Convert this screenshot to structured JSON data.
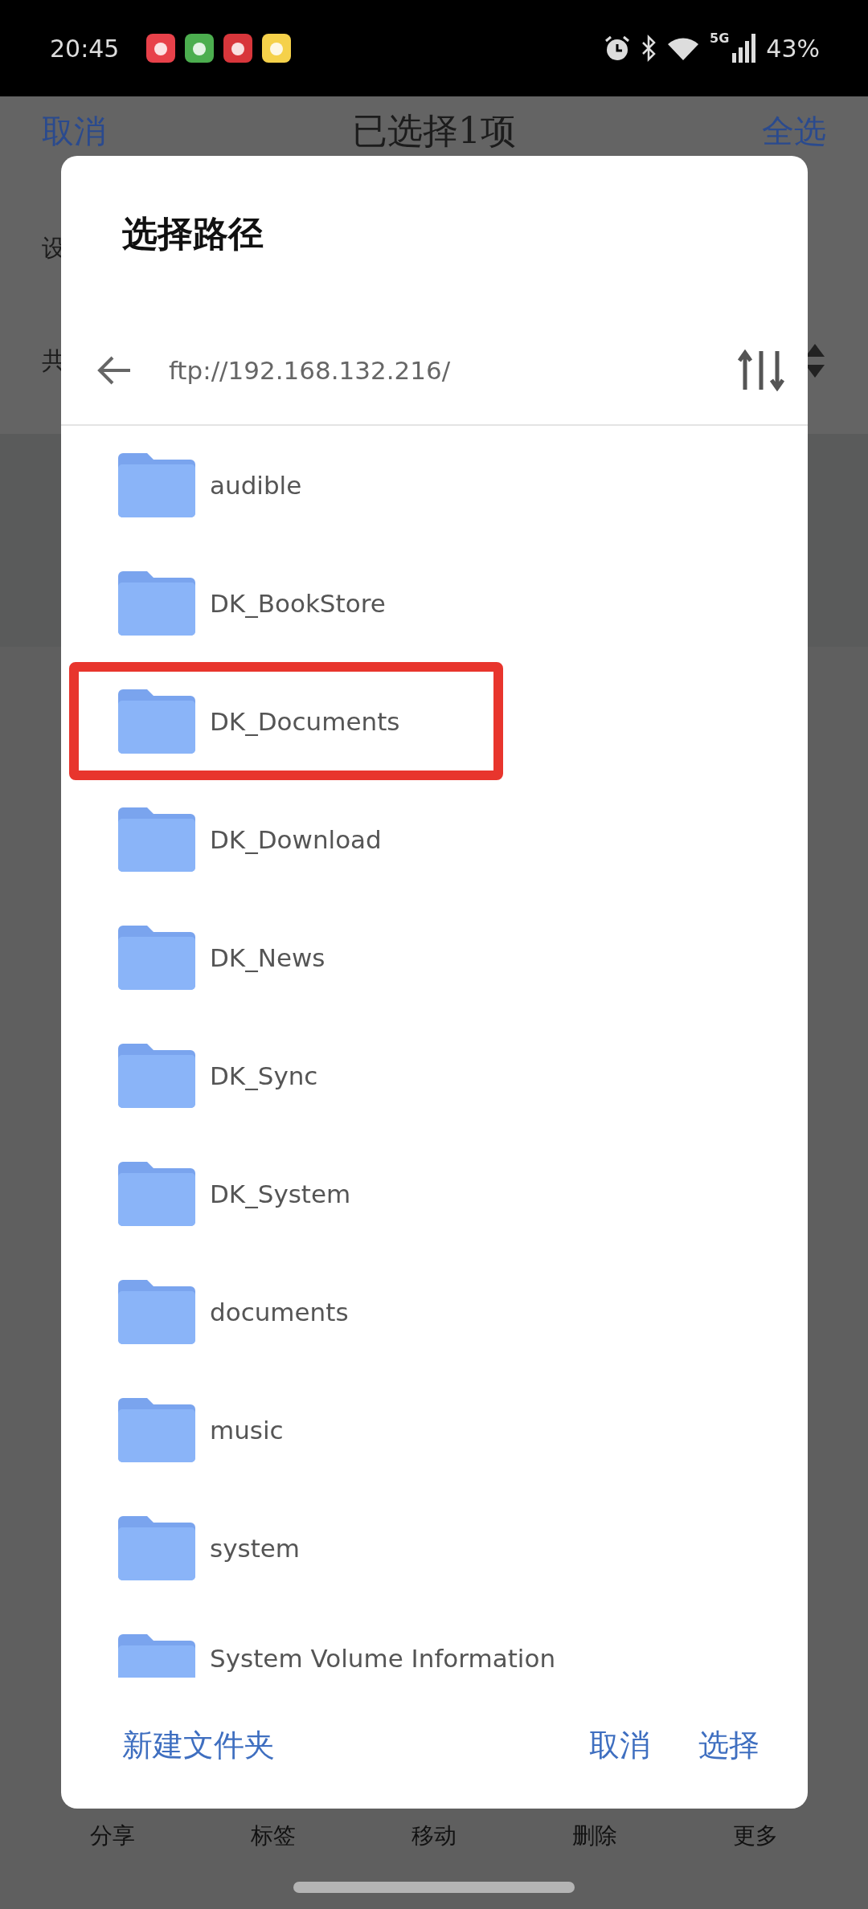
{
  "status_bar": {
    "time": "20:45",
    "network": "5G",
    "battery": "43%"
  },
  "page": {
    "cancel": "取消",
    "title": "已选择1项",
    "select_all": "全选",
    "label_1": "设",
    "label_2": "共"
  },
  "bottom_nav": [
    {
      "label": "分享"
    },
    {
      "label": "标签"
    },
    {
      "label": "移动"
    },
    {
      "label": "删除"
    },
    {
      "label": "更多"
    }
  ],
  "dialog": {
    "title": "选择路径",
    "path": "ftp://192.168.132.216/",
    "folders": [
      {
        "name": "audible",
        "highlighted": false
      },
      {
        "name": "DK_BookStore",
        "highlighted": false
      },
      {
        "name": "DK_Documents",
        "highlighted": true
      },
      {
        "name": "DK_Download",
        "highlighted": false
      },
      {
        "name": "DK_News",
        "highlighted": false
      },
      {
        "name": "DK_Sync",
        "highlighted": false
      },
      {
        "name": "DK_System",
        "highlighted": false
      },
      {
        "name": "documents",
        "highlighted": false
      },
      {
        "name": "music",
        "highlighted": false
      },
      {
        "name": "system",
        "highlighted": false
      },
      {
        "name": "System Volume Information",
        "highlighted": false
      }
    ],
    "buttons": {
      "new_folder": "新建文件夹",
      "cancel": "取消",
      "select": "选择"
    }
  }
}
